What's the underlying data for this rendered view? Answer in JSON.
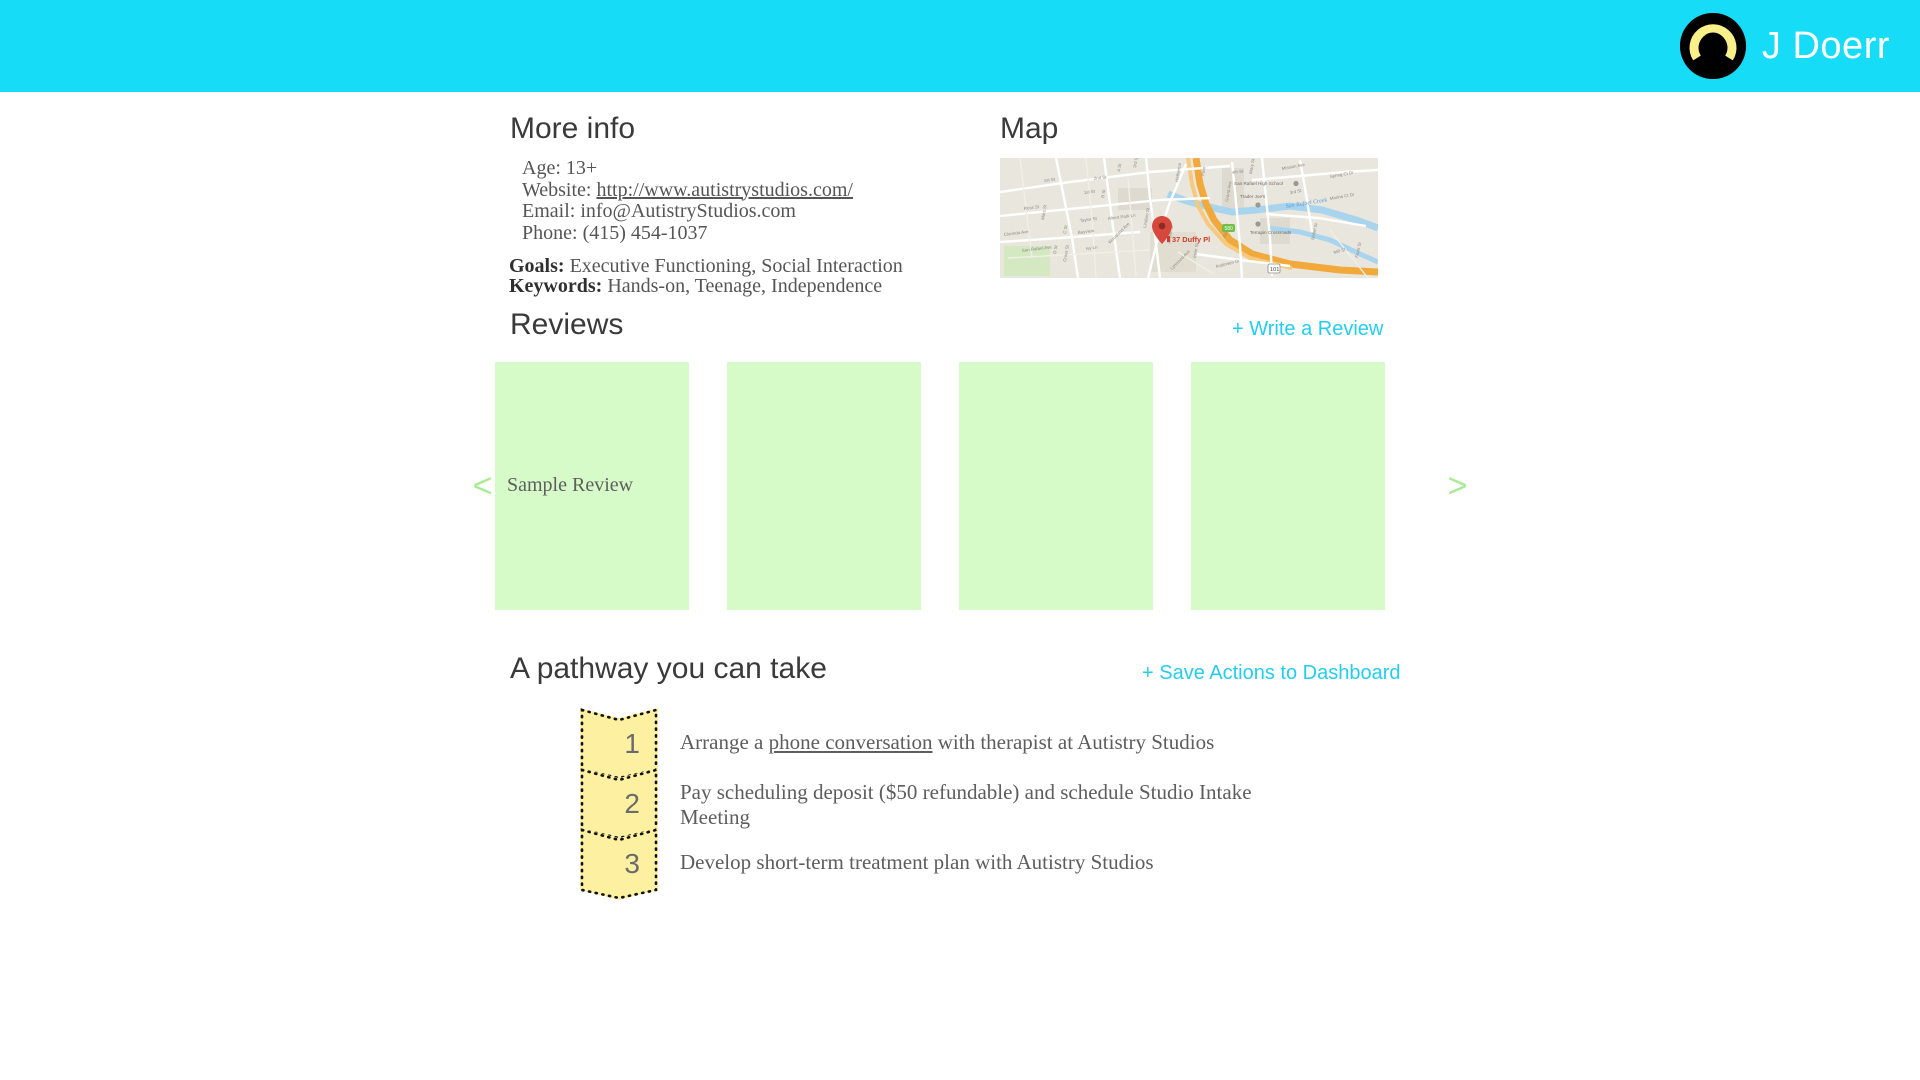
{
  "header": {
    "username": "J Doerr",
    "bar_color": "#16dcf8",
    "avatar_ring_color": "#faf08a",
    "avatar_bg_color": "#000000"
  },
  "more_info": {
    "title": "More info",
    "age_label": "Age:",
    "age_value": "13+",
    "website_label": "Website:",
    "website_value": "http://www.autistrystudios.com/",
    "email_label": "Email:",
    "email_value": "info@AutistryStudios.com",
    "phone_label": "Phone:",
    "phone_value": "(415) 454-1037",
    "goals_label": "Goals:",
    "goals_value": "Executive Functioning, Social Interaction",
    "keywords_label": "Keywords:",
    "keywords_value": "Hands-on, Teenage, Independence"
  },
  "map": {
    "title": "Map",
    "marker_label": "37 Duffy Pl",
    "street_labels": [
      "1st St",
      "2nd St",
      "3rd St",
      "4th St",
      "A St",
      "B St",
      "Ross St",
      "Taylor St",
      "Albert Park Ln",
      "Bayview",
      "Clorinda Ave",
      "San Rafael Ave",
      "Ivy Ln",
      "Lindaro St",
      "Woodland Ave",
      "Jordan St",
      "Irwin St",
      "Lynwood Ave",
      "Andersen Dr",
      "Mission Ave",
      "Mary St",
      "Grand Ave",
      "Francisco Blvd",
      "Front St",
      "Mill St",
      "Nebel St",
      "Marina Ct Dr",
      "Spring Ct Dr",
      "Cross St",
      "D St",
      "C St",
      "San Rafael Creek"
    ],
    "poi_labels": [
      "San Rafael High School",
      "Trader Joe's",
      "Terrapin Crossroads"
    ],
    "route_shields": [
      "101",
      "580"
    ]
  },
  "reviews": {
    "title": "Reviews",
    "write_review_label": "+  Write a Review",
    "prev_arrow": "<",
    "next_arrow": ">",
    "card_color": "#d6fbc9",
    "cards": [
      {
        "text": "Sample Review"
      },
      {
        "text": ""
      },
      {
        "text": ""
      },
      {
        "text": ""
      }
    ]
  },
  "pathway": {
    "title": "A pathway you can take",
    "save_actions_label": "+ Save Actions to Dashboard",
    "badge_color": "#fdf0a0",
    "steps": [
      {
        "number": "1",
        "text_before": "Arrange a ",
        "text_link": "phone conversation",
        "text_after": " with therapist at Autistry Studios"
      },
      {
        "number": "2",
        "text_before": "Pay scheduling deposit ($50 refundable) and schedule Studio Intake Meeting",
        "text_link": "",
        "text_after": ""
      },
      {
        "number": "3",
        "text_before": "Develop short-term treatment plan with Autistry Studios",
        "text_link": "",
        "text_after": ""
      }
    ]
  }
}
